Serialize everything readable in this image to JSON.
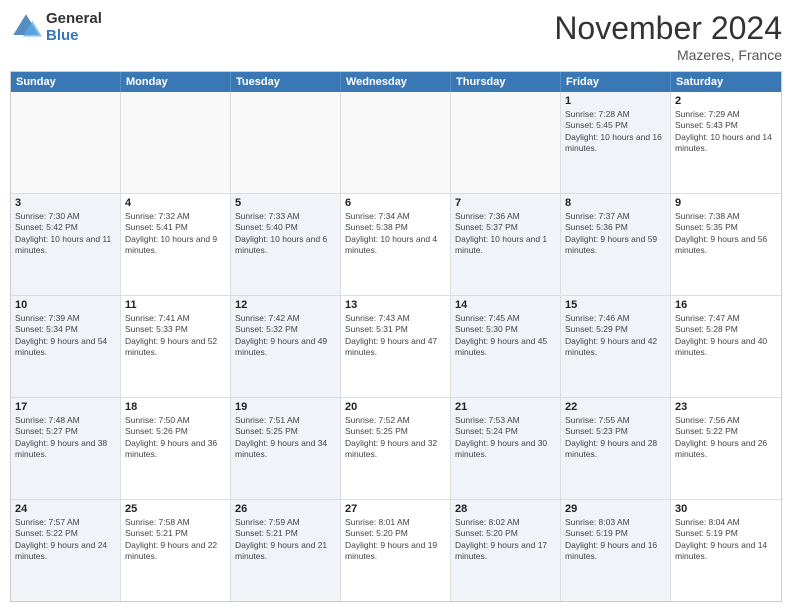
{
  "logo": {
    "line1": "General",
    "line2": "Blue"
  },
  "title": "November 2024",
  "location": "Mazeres, France",
  "headers": [
    "Sunday",
    "Monday",
    "Tuesday",
    "Wednesday",
    "Thursday",
    "Friday",
    "Saturday"
  ],
  "rows": [
    [
      {
        "day": "",
        "info": "",
        "empty": true
      },
      {
        "day": "",
        "info": "",
        "empty": true
      },
      {
        "day": "",
        "info": "",
        "empty": true
      },
      {
        "day": "",
        "info": "",
        "empty": true
      },
      {
        "day": "",
        "info": "",
        "empty": true
      },
      {
        "day": "1",
        "info": "Sunrise: 7:28 AM\nSunset: 5:45 PM\nDaylight: 10 hours and 16 minutes.",
        "empty": false,
        "shaded": true
      },
      {
        "day": "2",
        "info": "Sunrise: 7:29 AM\nSunset: 5:43 PM\nDaylight: 10 hours and 14 minutes.",
        "empty": false,
        "shaded": false
      }
    ],
    [
      {
        "day": "3",
        "info": "Sunrise: 7:30 AM\nSunset: 5:42 PM\nDaylight: 10 hours and 11 minutes.",
        "empty": false,
        "shaded": true
      },
      {
        "day": "4",
        "info": "Sunrise: 7:32 AM\nSunset: 5:41 PM\nDaylight: 10 hours and 9 minutes.",
        "empty": false,
        "shaded": false
      },
      {
        "day": "5",
        "info": "Sunrise: 7:33 AM\nSunset: 5:40 PM\nDaylight: 10 hours and 6 minutes.",
        "empty": false,
        "shaded": true
      },
      {
        "day": "6",
        "info": "Sunrise: 7:34 AM\nSunset: 5:38 PM\nDaylight: 10 hours and 4 minutes.",
        "empty": false,
        "shaded": false
      },
      {
        "day": "7",
        "info": "Sunrise: 7:36 AM\nSunset: 5:37 PM\nDaylight: 10 hours and 1 minute.",
        "empty": false,
        "shaded": true
      },
      {
        "day": "8",
        "info": "Sunrise: 7:37 AM\nSunset: 5:36 PM\nDaylight: 9 hours and 59 minutes.",
        "empty": false,
        "shaded": true
      },
      {
        "day": "9",
        "info": "Sunrise: 7:38 AM\nSunset: 5:35 PM\nDaylight: 9 hours and 56 minutes.",
        "empty": false,
        "shaded": false
      }
    ],
    [
      {
        "day": "10",
        "info": "Sunrise: 7:39 AM\nSunset: 5:34 PM\nDaylight: 9 hours and 54 minutes.",
        "empty": false,
        "shaded": true
      },
      {
        "day": "11",
        "info": "Sunrise: 7:41 AM\nSunset: 5:33 PM\nDaylight: 9 hours and 52 minutes.",
        "empty": false,
        "shaded": false
      },
      {
        "day": "12",
        "info": "Sunrise: 7:42 AM\nSunset: 5:32 PM\nDaylight: 9 hours and 49 minutes.",
        "empty": false,
        "shaded": true
      },
      {
        "day": "13",
        "info": "Sunrise: 7:43 AM\nSunset: 5:31 PM\nDaylight: 9 hours and 47 minutes.",
        "empty": false,
        "shaded": false
      },
      {
        "day": "14",
        "info": "Sunrise: 7:45 AM\nSunset: 5:30 PM\nDaylight: 9 hours and 45 minutes.",
        "empty": false,
        "shaded": true
      },
      {
        "day": "15",
        "info": "Sunrise: 7:46 AM\nSunset: 5:29 PM\nDaylight: 9 hours and 42 minutes.",
        "empty": false,
        "shaded": true
      },
      {
        "day": "16",
        "info": "Sunrise: 7:47 AM\nSunset: 5:28 PM\nDaylight: 9 hours and 40 minutes.",
        "empty": false,
        "shaded": false
      }
    ],
    [
      {
        "day": "17",
        "info": "Sunrise: 7:48 AM\nSunset: 5:27 PM\nDaylight: 9 hours and 38 minutes.",
        "empty": false,
        "shaded": true
      },
      {
        "day": "18",
        "info": "Sunrise: 7:50 AM\nSunset: 5:26 PM\nDaylight: 9 hours and 36 minutes.",
        "empty": false,
        "shaded": false
      },
      {
        "day": "19",
        "info": "Sunrise: 7:51 AM\nSunset: 5:25 PM\nDaylight: 9 hours and 34 minutes.",
        "empty": false,
        "shaded": true
      },
      {
        "day": "20",
        "info": "Sunrise: 7:52 AM\nSunset: 5:25 PM\nDaylight: 9 hours and 32 minutes.",
        "empty": false,
        "shaded": false
      },
      {
        "day": "21",
        "info": "Sunrise: 7:53 AM\nSunset: 5:24 PM\nDaylight: 9 hours and 30 minutes.",
        "empty": false,
        "shaded": true
      },
      {
        "day": "22",
        "info": "Sunrise: 7:55 AM\nSunset: 5:23 PM\nDaylight: 9 hours and 28 minutes.",
        "empty": false,
        "shaded": true
      },
      {
        "day": "23",
        "info": "Sunrise: 7:56 AM\nSunset: 5:22 PM\nDaylight: 9 hours and 26 minutes.",
        "empty": false,
        "shaded": false
      }
    ],
    [
      {
        "day": "24",
        "info": "Sunrise: 7:57 AM\nSunset: 5:22 PM\nDaylight: 9 hours and 24 minutes.",
        "empty": false,
        "shaded": true
      },
      {
        "day": "25",
        "info": "Sunrise: 7:58 AM\nSunset: 5:21 PM\nDaylight: 9 hours and 22 minutes.",
        "empty": false,
        "shaded": false
      },
      {
        "day": "26",
        "info": "Sunrise: 7:59 AM\nSunset: 5:21 PM\nDaylight: 9 hours and 21 minutes.",
        "empty": false,
        "shaded": true
      },
      {
        "day": "27",
        "info": "Sunrise: 8:01 AM\nSunset: 5:20 PM\nDaylight: 9 hours and 19 minutes.",
        "empty": false,
        "shaded": false
      },
      {
        "day": "28",
        "info": "Sunrise: 8:02 AM\nSunset: 5:20 PM\nDaylight: 9 hours and 17 minutes.",
        "empty": false,
        "shaded": true
      },
      {
        "day": "29",
        "info": "Sunrise: 8:03 AM\nSunset: 5:19 PM\nDaylight: 9 hours and 16 minutes.",
        "empty": false,
        "shaded": true
      },
      {
        "day": "30",
        "info": "Sunrise: 8:04 AM\nSunset: 5:19 PM\nDaylight: 9 hours and 14 minutes.",
        "empty": false,
        "shaded": false
      }
    ]
  ]
}
